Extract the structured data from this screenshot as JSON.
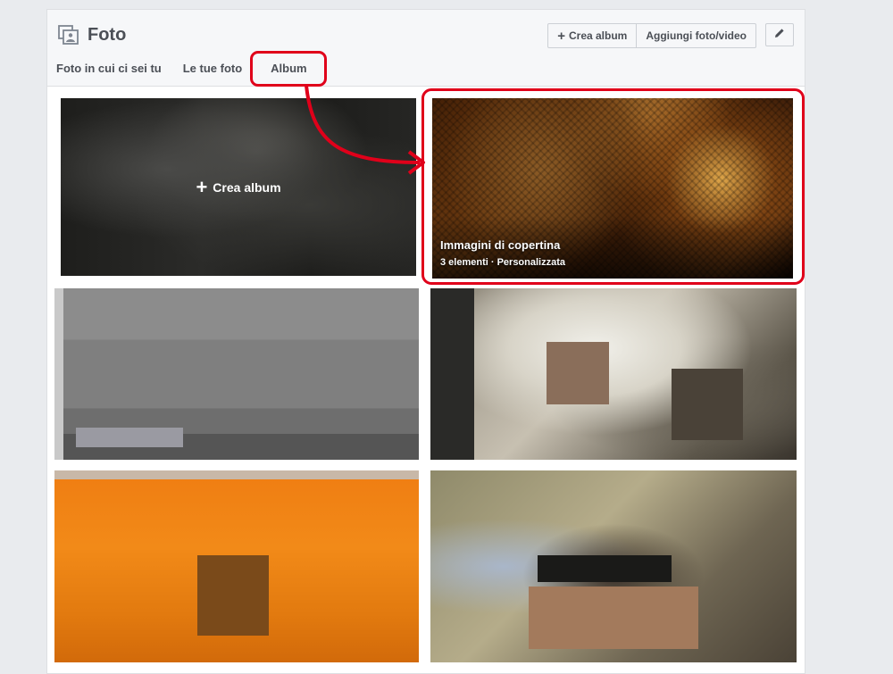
{
  "header": {
    "title": "Foto",
    "icon": "photos-icon",
    "buttons": {
      "create_album": "Crea album",
      "add_photo": "Aggiungi foto/video"
    },
    "edit_icon": "pencil-icon"
  },
  "tabs": [
    {
      "label": "Foto in cui ci sei tu",
      "active": false
    },
    {
      "label": "Le tue foto",
      "active": false
    },
    {
      "label": "Album",
      "active": true
    }
  ],
  "albums": {
    "create_tile_label": "Crea album",
    "cover_album": {
      "title": "Immagini di copertina",
      "meta": "3 elementi · Personalizzata"
    }
  },
  "annotation": {
    "color": "#e0001a"
  }
}
